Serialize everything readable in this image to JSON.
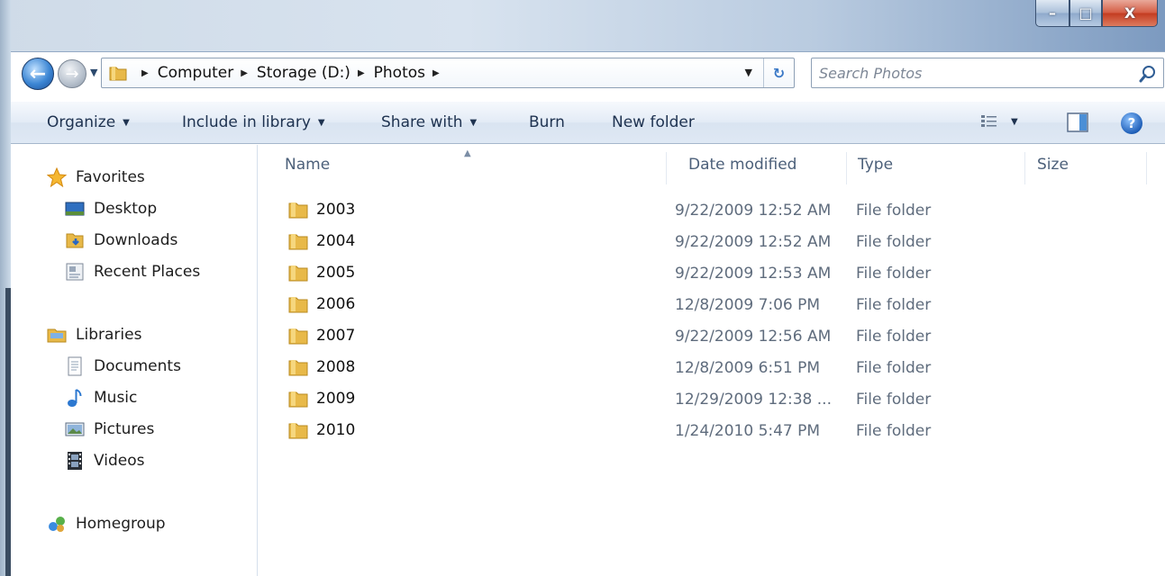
{
  "window": {
    "caption_buttons": {
      "minimize": "–",
      "maximize": "□",
      "close": "X"
    }
  },
  "nav": {
    "back_icon": "back-arrow-icon",
    "forward_icon": "forward-arrow-icon"
  },
  "address": {
    "crumbs": [
      "Computer",
      "Storage (D:)",
      "Photos"
    ]
  },
  "search": {
    "placeholder": "Search Photos"
  },
  "toolbar": {
    "organize": "Organize",
    "include_in_library": "Include in library",
    "share_with": "Share with",
    "burn": "Burn",
    "new_folder": "New folder"
  },
  "sidebar": {
    "favorites": {
      "label": "Favorites",
      "items": [
        "Desktop",
        "Downloads",
        "Recent Places"
      ]
    },
    "libraries": {
      "label": "Libraries",
      "items": [
        "Documents",
        "Music",
        "Pictures",
        "Videos"
      ]
    },
    "homegroup": "Homegroup"
  },
  "columns": {
    "name": "Name",
    "date_modified": "Date modified",
    "type": "Type",
    "size": "Size"
  },
  "files": [
    {
      "name": "2003",
      "date": "9/22/2009 12:52 AM",
      "type": "File folder"
    },
    {
      "name": "2004",
      "date": "9/22/2009 12:52 AM",
      "type": "File folder"
    },
    {
      "name": "2005",
      "date": "9/22/2009 12:53 AM",
      "type": "File folder"
    },
    {
      "name": "2006",
      "date": "12/8/2009 7:06 PM",
      "type": "File folder"
    },
    {
      "name": "2007",
      "date": "9/22/2009 12:56 AM",
      "type": "File folder"
    },
    {
      "name": "2008",
      "date": "12/8/2009 6:51 PM",
      "type": "File folder"
    },
    {
      "name": "2009",
      "date": "12/29/2009 12:38 ...",
      "type": "File folder"
    },
    {
      "name": "2010",
      "date": "1/24/2010 5:47 PM",
      "type": "File folder"
    }
  ],
  "colors": {
    "accent": "#1e3250",
    "folder": "#e8b949",
    "secondary_text": "#5f6c7d"
  }
}
